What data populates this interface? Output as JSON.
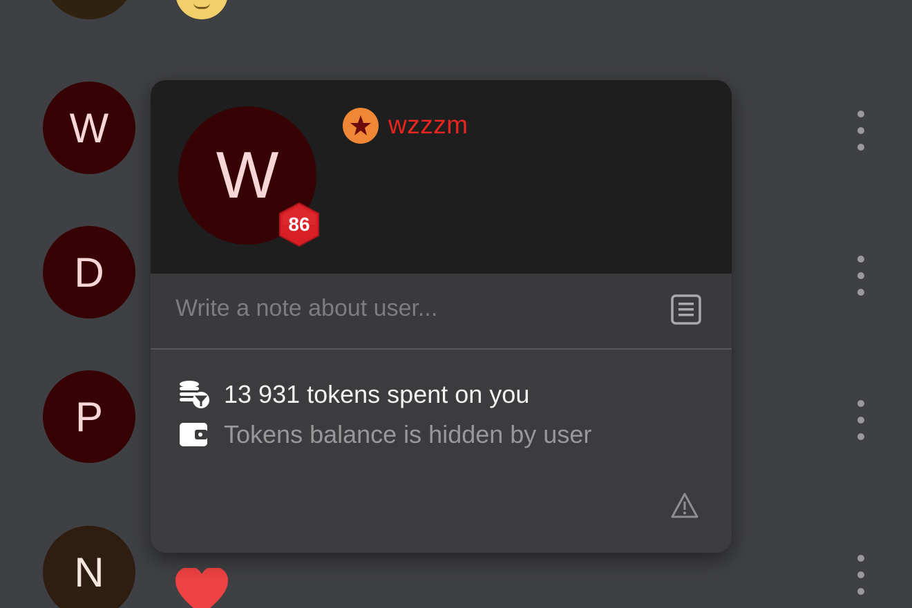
{
  "background_rows": [
    {
      "initial": "W"
    },
    {
      "initial": "D"
    },
    {
      "initial": "P"
    },
    {
      "initial": "N"
    }
  ],
  "profile_card": {
    "avatar_initial": "W",
    "level": "86",
    "username": "wzzzm",
    "username_color": "#e8251e",
    "note_placeholder": "Write a note about user...",
    "note_value": "",
    "tokens_spent": "13 931 tokens spent on you",
    "tokens_balance": "Tokens balance is hidden by user"
  },
  "icons": {
    "rank": "star-badge-icon",
    "note": "note-document-icon",
    "tokens": "coins-icon",
    "wallet": "wallet-icon",
    "report": "warning-icon",
    "row_menu": "more-vertical-icon"
  },
  "colors": {
    "background": "#3f4043",
    "card_header": "#1e1e1e",
    "card_body": "#3c3c3e",
    "avatar_red": "#360203",
    "level_badge": "#d81f26",
    "rank_badge": "#ef8736"
  }
}
